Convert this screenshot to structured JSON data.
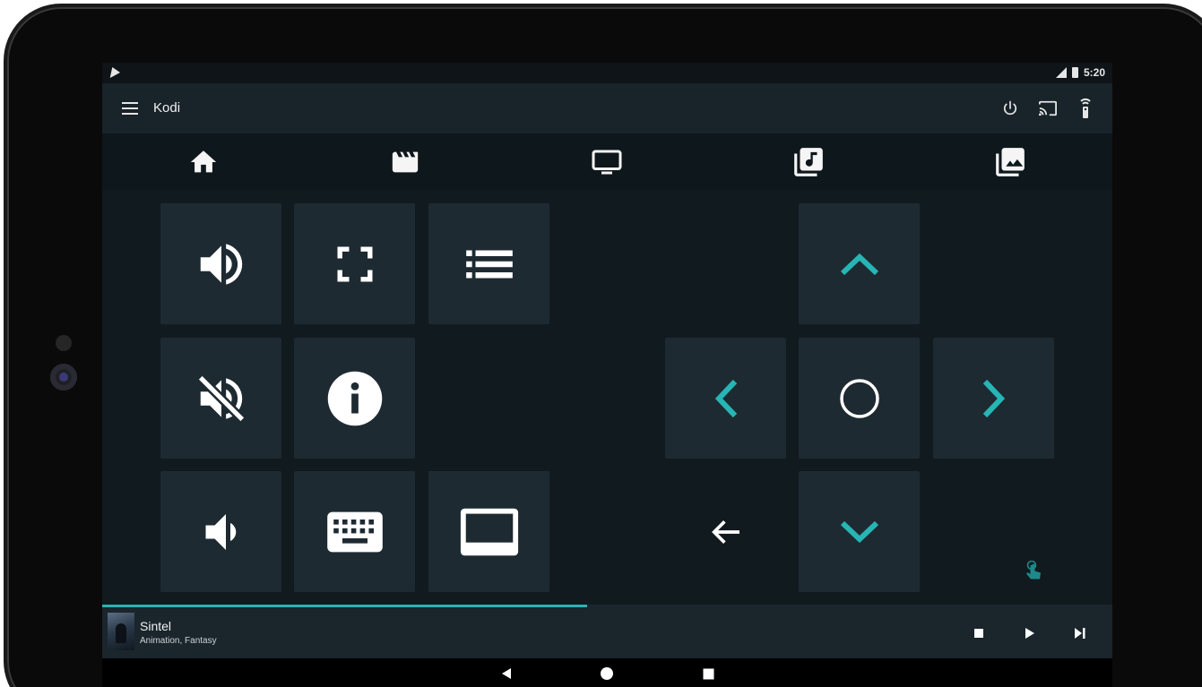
{
  "statusbar": {
    "time": "5:20"
  },
  "appbar": {
    "title": "Kodi"
  },
  "icons": {
    "menu": "hamburger-menu-icon",
    "power": "power-icon",
    "cast": "cast-icon",
    "remote": "remote-icon",
    "home": "home-icon",
    "movies": "movie-clapper-icon",
    "tv": "tv-icon",
    "music": "music-library-icon",
    "pictures": "photo-library-icon"
  },
  "nowplaying": {
    "title": "Sintel",
    "subtitle": "Animation, Fantasy",
    "progress": 0.48
  },
  "colors": {
    "accent": "#27b5b5",
    "background": "#111a1f",
    "tile": "#1e2a31",
    "appbar": "#18232a"
  }
}
